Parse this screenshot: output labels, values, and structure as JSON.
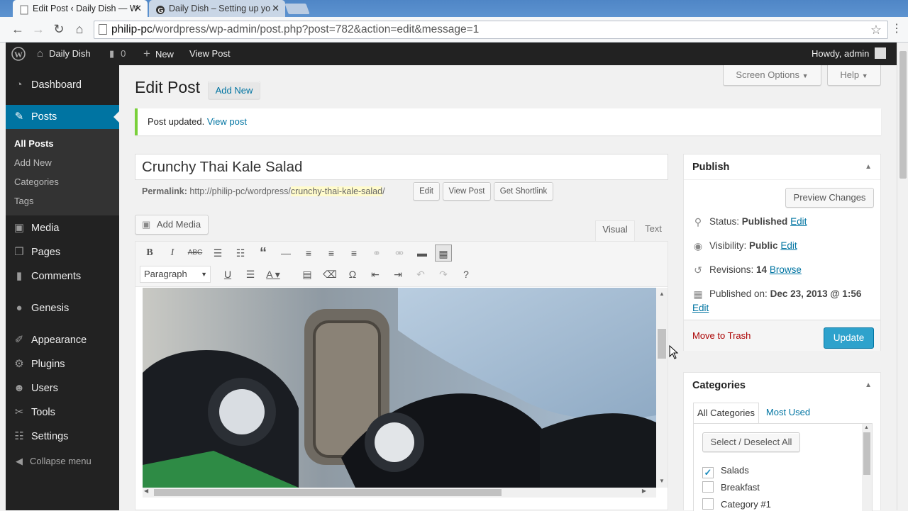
{
  "browser": {
    "tabs": [
      {
        "title": "Edit Post ‹ Daily Dish — W",
        "close": "✕"
      },
      {
        "title": "Daily Dish – Setting up yo",
        "close": "✕"
      }
    ],
    "url_scheme_host": "philip-pc",
    "url_path": "/wordpress/wp-admin/post.php?post=782&action=edit&message=1"
  },
  "adminbar": {
    "site_name": "Daily Dish",
    "comments_count": "0",
    "new_label": "New",
    "view_post": "View Post",
    "howdy": "Howdy, admin"
  },
  "sidebar": {
    "items": [
      {
        "label": "Dashboard",
        "icon": "dashboard-icon"
      },
      {
        "label": "Posts",
        "icon": "pin-icon"
      },
      {
        "label": "Media",
        "icon": "media-icon"
      },
      {
        "label": "Pages",
        "icon": "pages-icon"
      },
      {
        "label": "Comments",
        "icon": "comments-icon"
      },
      {
        "label": "Genesis",
        "icon": "genesis-icon"
      },
      {
        "label": "Appearance",
        "icon": "brush-icon"
      },
      {
        "label": "Plugins",
        "icon": "plugin-icon"
      },
      {
        "label": "Users",
        "icon": "users-icon"
      },
      {
        "label": "Tools",
        "icon": "wrench-icon"
      },
      {
        "label": "Settings",
        "icon": "settings-icon"
      }
    ],
    "submenu": [
      "All Posts",
      "Add New",
      "Categories",
      "Tags"
    ],
    "collapse": "Collapse menu"
  },
  "header": {
    "screen_options": "Screen Options",
    "help": "Help",
    "title": "Edit Post",
    "add_new": "Add New"
  },
  "notice": {
    "text": "Post updated.",
    "link": "View post"
  },
  "post": {
    "title": "Crunchy Thai Kale Salad",
    "permalink_label": "Permalink:",
    "permalink_base": "http://philip-pc/wordpress/",
    "permalink_slug": "crunchy-thai-kale-salad",
    "permalink_end": "/",
    "edit_btn": "Edit",
    "view_btn": "View Post",
    "shortlink_btn": "Get Shortlink"
  },
  "editor": {
    "add_media": "Add Media",
    "tab_visual": "Visual",
    "tab_text": "Text",
    "format_select": "Paragraph"
  },
  "publish": {
    "title": "Publish",
    "preview": "Preview Changes",
    "status_label": "Status:",
    "status_value": "Published",
    "visibility_label": "Visibility:",
    "visibility_value": "Public",
    "revisions_label": "Revisions:",
    "revisions_value": "14",
    "browse": "Browse",
    "published_label": "Published on:",
    "published_value": "Dec 23, 2013 @ 1:56",
    "edit": "Edit",
    "trash": "Move to Trash",
    "update": "Update"
  },
  "categories": {
    "title": "Categories",
    "tab_all": "All Categories",
    "tab_used": "Most Used",
    "select_all": "Select / Deselect All",
    "items": [
      {
        "label": "Salads",
        "checked": true
      },
      {
        "label": "Breakfast",
        "checked": false
      },
      {
        "label": "Category #1",
        "checked": false
      }
    ]
  },
  "colors": {
    "accent": "#0074a2",
    "update_btn": "#2ea2cc",
    "notice_border": "#7ad03a",
    "trash": "#a00"
  }
}
